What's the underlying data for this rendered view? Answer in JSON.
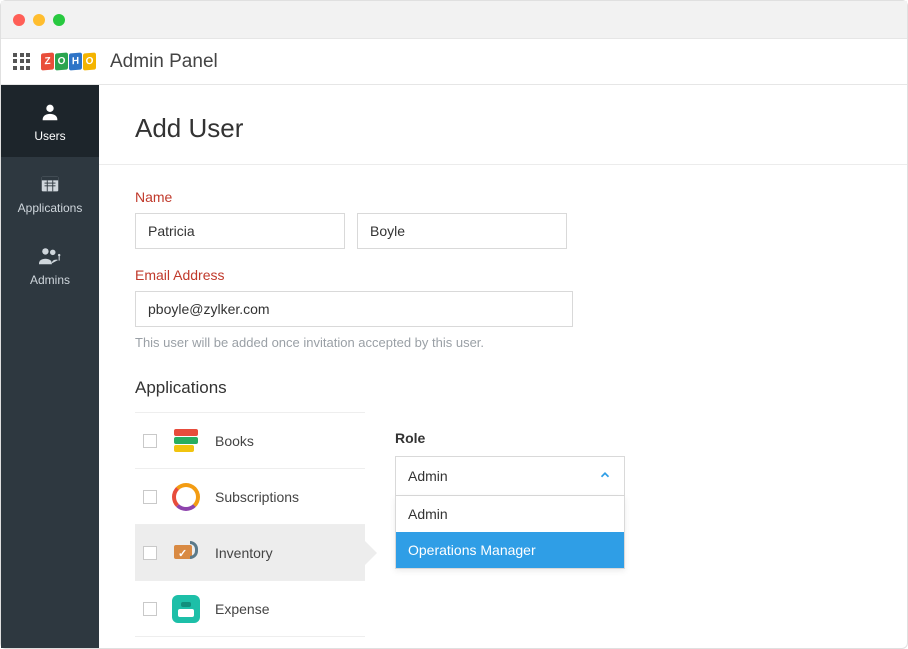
{
  "header": {
    "title": "Admin Panel"
  },
  "sidebar": {
    "items": [
      {
        "label": "Users"
      },
      {
        "label": "Applications"
      },
      {
        "label": "Admins"
      }
    ]
  },
  "page": {
    "title": "Add User",
    "name_label": "Name",
    "first_name": "Patricia",
    "last_name": "Boyle",
    "email_label": "Email Address",
    "email": "pboyle@zylker.com",
    "email_hint": "This user will be added once invitation accepted by this user.",
    "apps_label": "Applications"
  },
  "apps": [
    {
      "label": "Books"
    },
    {
      "label": "Subscriptions"
    },
    {
      "label": "Inventory"
    },
    {
      "label": "Expense"
    }
  ],
  "role": {
    "label": "Role",
    "selected": "Admin",
    "options": [
      "Admin",
      "Operations Manager"
    ]
  }
}
